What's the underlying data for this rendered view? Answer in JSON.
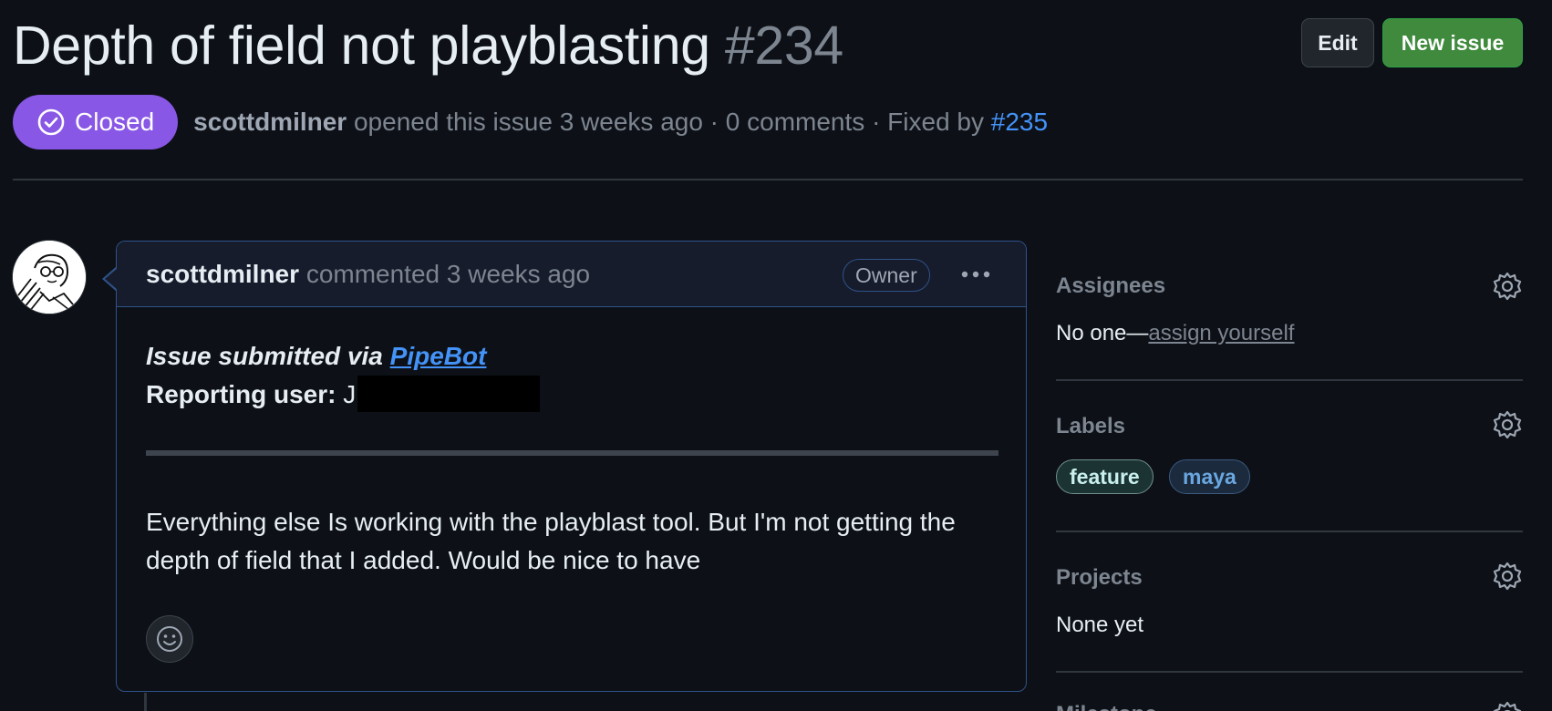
{
  "header": {
    "title": "Depth of field not playblasting",
    "number": "#234",
    "edit_label": "Edit",
    "new_issue_label": "New issue"
  },
  "status": {
    "state": "Closed",
    "author": "scottdmilner",
    "opened_text": "opened this issue 3 weeks ago · 0 comments · Fixed by",
    "fixed_by": "#235"
  },
  "comment": {
    "author": "scottdmilner",
    "action": "commented 3 weeks ago",
    "role": "Owner",
    "submitted_prefix": "Issue submitted via",
    "submitted_link": "PipeBot",
    "reporting_label": "Reporting user:",
    "reporting_value": "J",
    "body": "Everything else Is working with the playblast tool. But I'm not getting the depth of field that I added. Would be nice to have"
  },
  "sidebar": {
    "assignees": {
      "title": "Assignees",
      "value_prefix": "No one—",
      "assign_link": "assign yourself"
    },
    "labels": {
      "title": "Labels",
      "items": [
        "feature",
        "maya"
      ]
    },
    "projects": {
      "title": "Projects",
      "value": "None yet"
    },
    "milestone": {
      "title": "Milestone"
    }
  },
  "colors": {
    "closed_badge": "#8957e5",
    "new_issue_button": "#3f8a3d",
    "link": "#4493f8"
  }
}
